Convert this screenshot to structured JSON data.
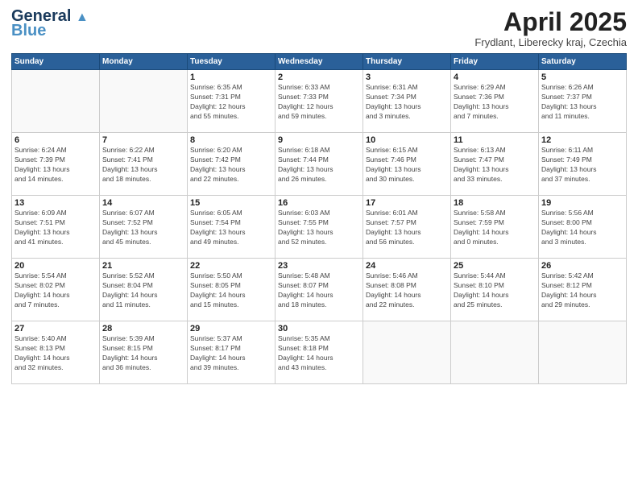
{
  "header": {
    "logo_line1": "General",
    "logo_line2": "Blue",
    "month_title": "April 2025",
    "location": "Frydlant, Liberecky kraj, Czechia"
  },
  "weekdays": [
    "Sunday",
    "Monday",
    "Tuesday",
    "Wednesday",
    "Thursday",
    "Friday",
    "Saturday"
  ],
  "weeks": [
    [
      {
        "day": "",
        "detail": ""
      },
      {
        "day": "",
        "detail": ""
      },
      {
        "day": "1",
        "detail": "Sunrise: 6:35 AM\nSunset: 7:31 PM\nDaylight: 12 hours\nand 55 minutes."
      },
      {
        "day": "2",
        "detail": "Sunrise: 6:33 AM\nSunset: 7:33 PM\nDaylight: 12 hours\nand 59 minutes."
      },
      {
        "day": "3",
        "detail": "Sunrise: 6:31 AM\nSunset: 7:34 PM\nDaylight: 13 hours\nand 3 minutes."
      },
      {
        "day": "4",
        "detail": "Sunrise: 6:29 AM\nSunset: 7:36 PM\nDaylight: 13 hours\nand 7 minutes."
      },
      {
        "day": "5",
        "detail": "Sunrise: 6:26 AM\nSunset: 7:37 PM\nDaylight: 13 hours\nand 11 minutes."
      }
    ],
    [
      {
        "day": "6",
        "detail": "Sunrise: 6:24 AM\nSunset: 7:39 PM\nDaylight: 13 hours\nand 14 minutes."
      },
      {
        "day": "7",
        "detail": "Sunrise: 6:22 AM\nSunset: 7:41 PM\nDaylight: 13 hours\nand 18 minutes."
      },
      {
        "day": "8",
        "detail": "Sunrise: 6:20 AM\nSunset: 7:42 PM\nDaylight: 13 hours\nand 22 minutes."
      },
      {
        "day": "9",
        "detail": "Sunrise: 6:18 AM\nSunset: 7:44 PM\nDaylight: 13 hours\nand 26 minutes."
      },
      {
        "day": "10",
        "detail": "Sunrise: 6:15 AM\nSunset: 7:46 PM\nDaylight: 13 hours\nand 30 minutes."
      },
      {
        "day": "11",
        "detail": "Sunrise: 6:13 AM\nSunset: 7:47 PM\nDaylight: 13 hours\nand 33 minutes."
      },
      {
        "day": "12",
        "detail": "Sunrise: 6:11 AM\nSunset: 7:49 PM\nDaylight: 13 hours\nand 37 minutes."
      }
    ],
    [
      {
        "day": "13",
        "detail": "Sunrise: 6:09 AM\nSunset: 7:51 PM\nDaylight: 13 hours\nand 41 minutes."
      },
      {
        "day": "14",
        "detail": "Sunrise: 6:07 AM\nSunset: 7:52 PM\nDaylight: 13 hours\nand 45 minutes."
      },
      {
        "day": "15",
        "detail": "Sunrise: 6:05 AM\nSunset: 7:54 PM\nDaylight: 13 hours\nand 49 minutes."
      },
      {
        "day": "16",
        "detail": "Sunrise: 6:03 AM\nSunset: 7:55 PM\nDaylight: 13 hours\nand 52 minutes."
      },
      {
        "day": "17",
        "detail": "Sunrise: 6:01 AM\nSunset: 7:57 PM\nDaylight: 13 hours\nand 56 minutes."
      },
      {
        "day": "18",
        "detail": "Sunrise: 5:58 AM\nSunset: 7:59 PM\nDaylight: 14 hours\nand 0 minutes."
      },
      {
        "day": "19",
        "detail": "Sunrise: 5:56 AM\nSunset: 8:00 PM\nDaylight: 14 hours\nand 3 minutes."
      }
    ],
    [
      {
        "day": "20",
        "detail": "Sunrise: 5:54 AM\nSunset: 8:02 PM\nDaylight: 14 hours\nand 7 minutes."
      },
      {
        "day": "21",
        "detail": "Sunrise: 5:52 AM\nSunset: 8:04 PM\nDaylight: 14 hours\nand 11 minutes."
      },
      {
        "day": "22",
        "detail": "Sunrise: 5:50 AM\nSunset: 8:05 PM\nDaylight: 14 hours\nand 15 minutes."
      },
      {
        "day": "23",
        "detail": "Sunrise: 5:48 AM\nSunset: 8:07 PM\nDaylight: 14 hours\nand 18 minutes."
      },
      {
        "day": "24",
        "detail": "Sunrise: 5:46 AM\nSunset: 8:08 PM\nDaylight: 14 hours\nand 22 minutes."
      },
      {
        "day": "25",
        "detail": "Sunrise: 5:44 AM\nSunset: 8:10 PM\nDaylight: 14 hours\nand 25 minutes."
      },
      {
        "day": "26",
        "detail": "Sunrise: 5:42 AM\nSunset: 8:12 PM\nDaylight: 14 hours\nand 29 minutes."
      }
    ],
    [
      {
        "day": "27",
        "detail": "Sunrise: 5:40 AM\nSunset: 8:13 PM\nDaylight: 14 hours\nand 32 minutes."
      },
      {
        "day": "28",
        "detail": "Sunrise: 5:39 AM\nSunset: 8:15 PM\nDaylight: 14 hours\nand 36 minutes."
      },
      {
        "day": "29",
        "detail": "Sunrise: 5:37 AM\nSunset: 8:17 PM\nDaylight: 14 hours\nand 39 minutes."
      },
      {
        "day": "30",
        "detail": "Sunrise: 5:35 AM\nSunset: 8:18 PM\nDaylight: 14 hours\nand 43 minutes."
      },
      {
        "day": "",
        "detail": ""
      },
      {
        "day": "",
        "detail": ""
      },
      {
        "day": "",
        "detail": ""
      }
    ]
  ]
}
